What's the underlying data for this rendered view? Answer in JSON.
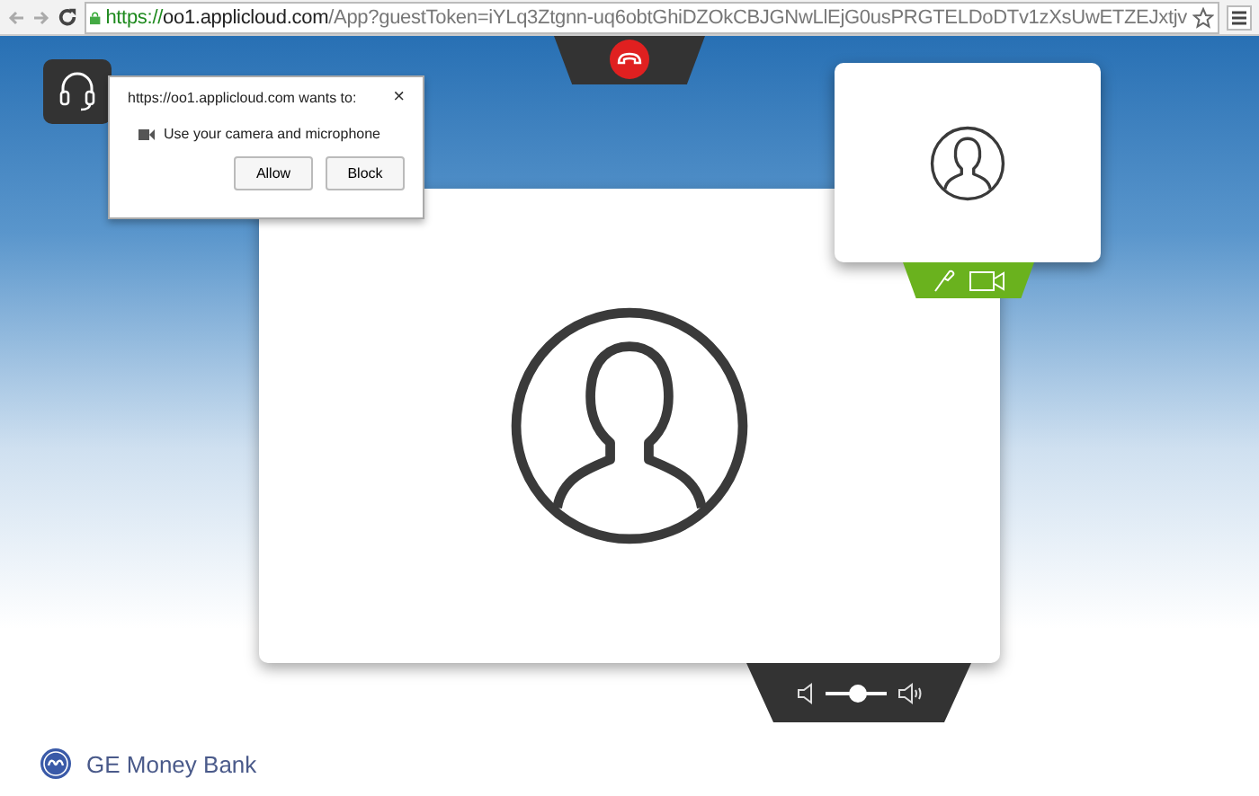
{
  "browser": {
    "url": {
      "scheme": "https://",
      "host": "oo1.applicloud.com",
      "path": "/App?guestToken=iYLq3Ztgnn-uq6obtGhiDZOkCBJGNwLlEjG0usPRGTELDoDTv1zXsUwETZEJxtjv"
    }
  },
  "permission_popup": {
    "origin": "https://oo1.applicloud.com wants to:",
    "close": "×",
    "request": "Use your camera and microphone",
    "buttons": [
      "Allow",
      "Block"
    ]
  },
  "volume": {
    "level": 0.53
  },
  "brand": {
    "name": "GE Money Bank"
  }
}
